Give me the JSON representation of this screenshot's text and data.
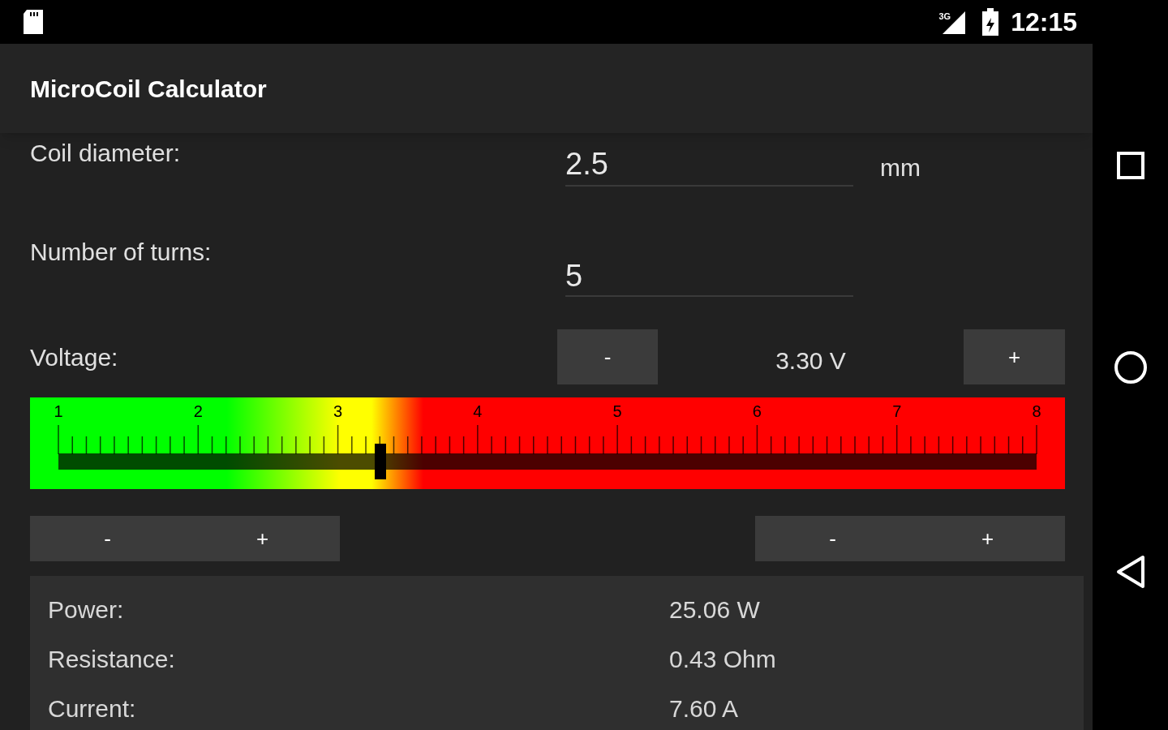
{
  "status_bar": {
    "network": "3G",
    "time": "12:15"
  },
  "app_bar": {
    "title": "MicroCoil Calculator"
  },
  "inputs": [
    {
      "label": "Coil diameter:",
      "value": "2.5",
      "unit": "mm"
    },
    {
      "label": "Number of turns:",
      "value": "5"
    }
  ],
  "voltage": {
    "label": "Voltage:",
    "decrement": "-",
    "reading": "3.30 V",
    "increment": "+"
  },
  "meter": {
    "scale_labels": [
      "1",
      "2",
      "3",
      "4",
      "5",
      "6",
      "7",
      "8"
    ],
    "level": 0.329
  },
  "adjust_pairs": [
    {
      "decrement": "-",
      "increment": "+"
    },
    {
      "decrement": "-",
      "increment": "+"
    }
  ],
  "results": [
    {
      "label": "Power:",
      "value": "25.06 W"
    },
    {
      "label": "Resistance:",
      "value": "0.43 Ohm"
    },
    {
      "label": "Current:",
      "value": "7.60 A"
    }
  ]
}
